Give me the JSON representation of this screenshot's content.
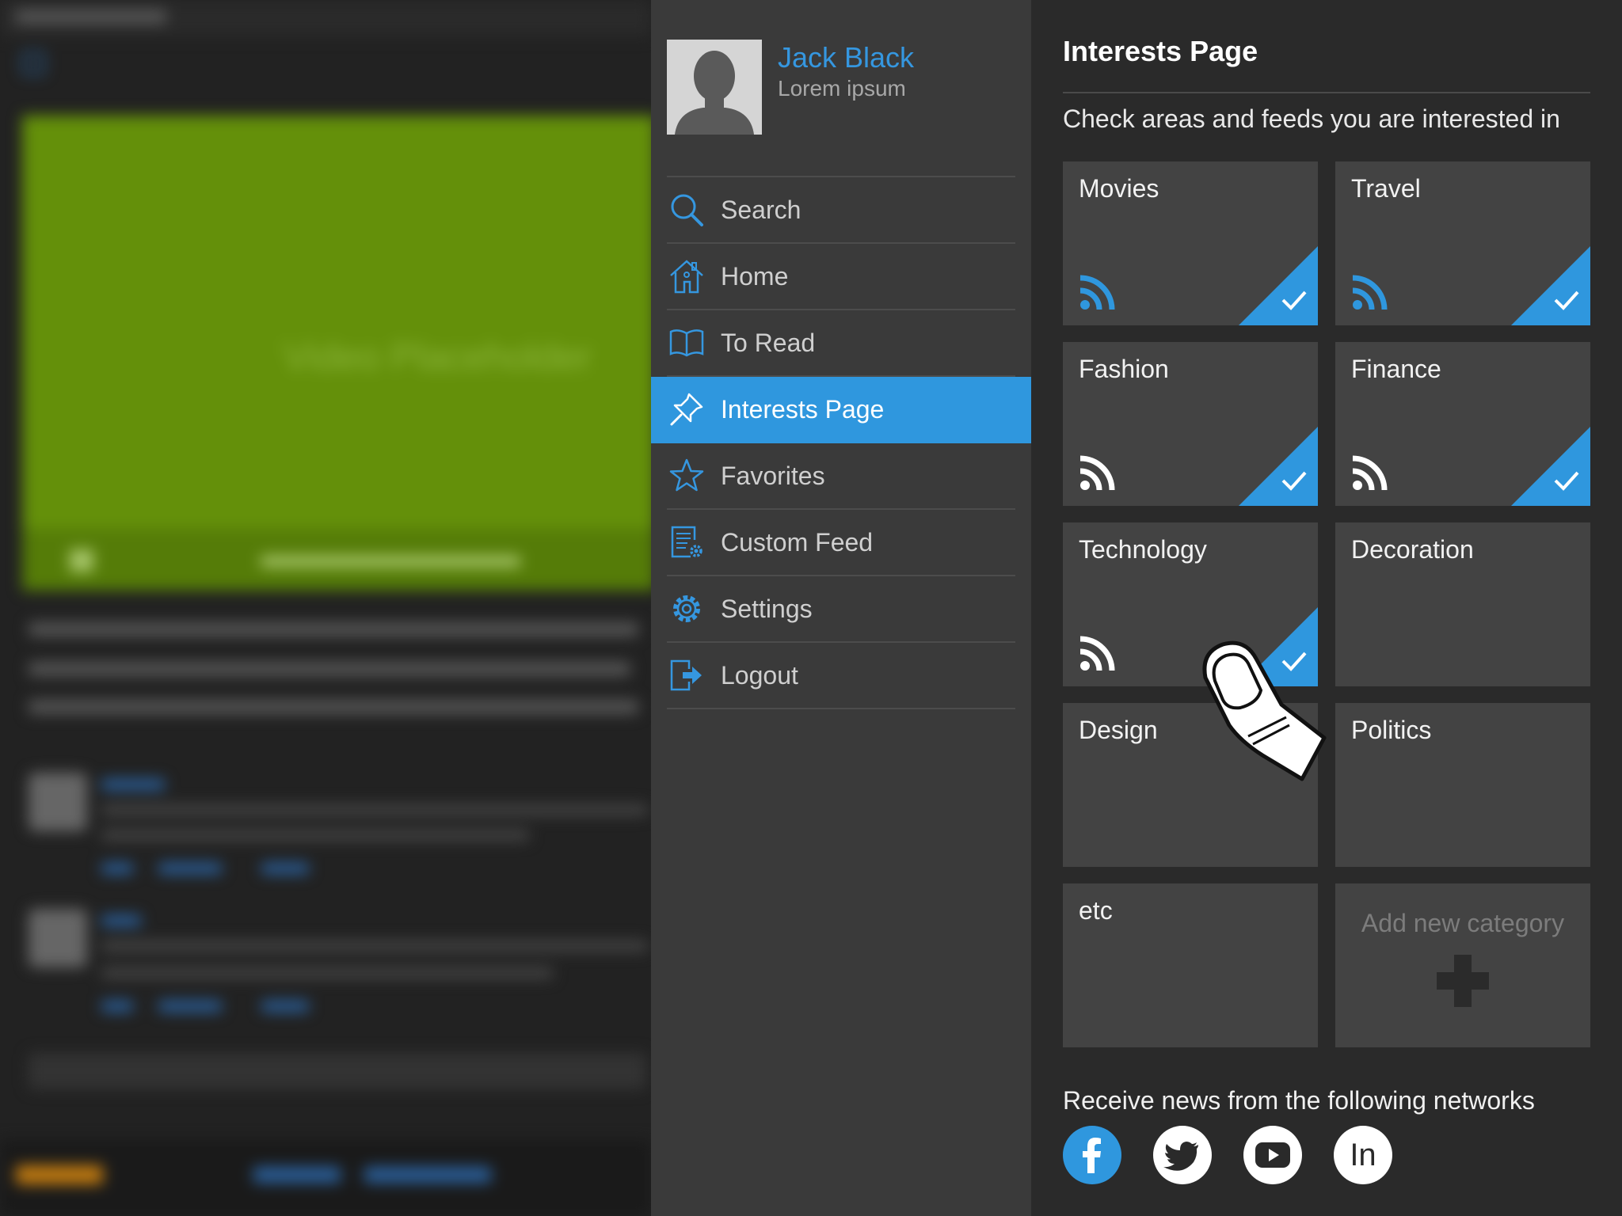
{
  "profile": {
    "name": "Jack Black",
    "subtitle": "Lorem ipsum"
  },
  "menu": {
    "items": [
      {
        "label": "Search",
        "icon": "search-icon"
      },
      {
        "label": "Home",
        "icon": "home-icon"
      },
      {
        "label": "To Read",
        "icon": "book-icon"
      },
      {
        "label": "Interests Page",
        "icon": "pin-icon",
        "active": true
      },
      {
        "label": "Favorites",
        "icon": "star-icon"
      },
      {
        "label": "Custom Feed",
        "icon": "feed-settings-icon"
      },
      {
        "label": "Settings",
        "icon": "gear-icon"
      },
      {
        "label": "Logout",
        "icon": "logout-icon"
      }
    ]
  },
  "panel": {
    "title": "Interests Page",
    "instruction": "Check areas and feeds you are interested in",
    "networks_label": "Receive news from the following networks"
  },
  "tiles": [
    {
      "label": "Movies",
      "rss": "blue",
      "checked": true
    },
    {
      "label": "Travel",
      "rss": "blue",
      "checked": true
    },
    {
      "label": "Fashion",
      "rss": "white",
      "checked": true
    },
    {
      "label": "Finance",
      "rss": "white",
      "checked": true
    },
    {
      "label": "Technology",
      "rss": "white",
      "checked": true
    },
    {
      "label": "Decoration",
      "rss": "none",
      "checked": false
    },
    {
      "label": "Design",
      "rss": "none",
      "checked": false
    },
    {
      "label": "Politics",
      "rss": "none",
      "checked": false
    },
    {
      "label": "etc",
      "rss": "none",
      "checked": false
    }
  ],
  "add_tile": {
    "label": "Add new category",
    "icon": "plus-icon"
  },
  "networks": [
    {
      "name": "facebook-icon",
      "glyph": "f",
      "color": "#2f97de"
    },
    {
      "name": "twitter-icon",
      "glyph": "",
      "color": "#ffffff"
    },
    {
      "name": "youtube-icon",
      "glyph": "",
      "color": "#ffffff"
    },
    {
      "name": "linkedin-icon",
      "glyph": "In",
      "color": "#ffffff"
    }
  ],
  "colors": {
    "accent": "#2f97de",
    "menu_bg": "#3a3a3a",
    "panel_bg": "#2a2a2a",
    "tile_bg": "#434343"
  }
}
